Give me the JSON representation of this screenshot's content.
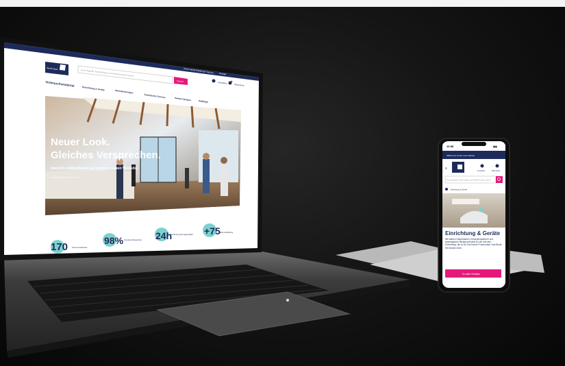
{
  "laptop": {
    "announcement": "Willkommen auf der neuen Website: Neu: Zahnersatz und Lieferung an Deine Praxis",
    "top_links": [
      "Deine Dental Rabatt",
      "24/7 Service",
      "Kontakt"
    ],
    "logo_text": "dental bauer",
    "search_placeholder": "Durch Begriffe, Anwendungen und Artikelnummern suchen",
    "search_button": "Suchen",
    "account_label": "Anmelden",
    "cart_label": "Warenkorb",
    "nav": [
      "Verbrauchsmaterial",
      "Einrichtung & Geräte",
      "Dienstleistungen",
      "Technischer Service",
      "Dental Campus",
      "Kataloge"
    ],
    "hero": {
      "title_line1": "Neuer Look.",
      "title_line2": "Gleiches Versprechen.",
      "subtitle": "Herzlich willkommen auf unserer neuen Website.",
      "link": "Lernen Sie uns kennen >"
    },
    "stats": [
      {
        "value": "170",
        "label": "Servicemitarbeiter"
      },
      {
        "value": "98%",
        "label": "Kundenzufriedenheit"
      },
      {
        "value": "24h",
        "label": "Lieferung auf Lagerartikel"
      },
      {
        "value": "+75",
        "label": "Jahre Erfahrung"
      }
    ]
  },
  "phone": {
    "time": "10:58",
    "signal": "▮▮▮",
    "announcement": "Willkommen auf der neuen Website",
    "search_placeholder": "Durch Begriffe, Anwendungen und Artikelnummern suchen",
    "account_label": "Anmelden",
    "cart_label": "Warenkorb",
    "breadcrumb": "Einrichtung & Geräte",
    "title": "Einrichtung & Geräte",
    "body": "Mit starken Hauptmarken, Entwicklerpartnern und bestmöglicher Beratung findest Du bei uns eine Einrichtung, die zu Dir und Deiner Praxis passt. Das Beste: Wir beraten Dich.",
    "cta": "Zu allen Geräten"
  },
  "colors": {
    "navy": "#1c2b5a",
    "pink": "#e5197a",
    "teal": "#7fd1cf"
  }
}
